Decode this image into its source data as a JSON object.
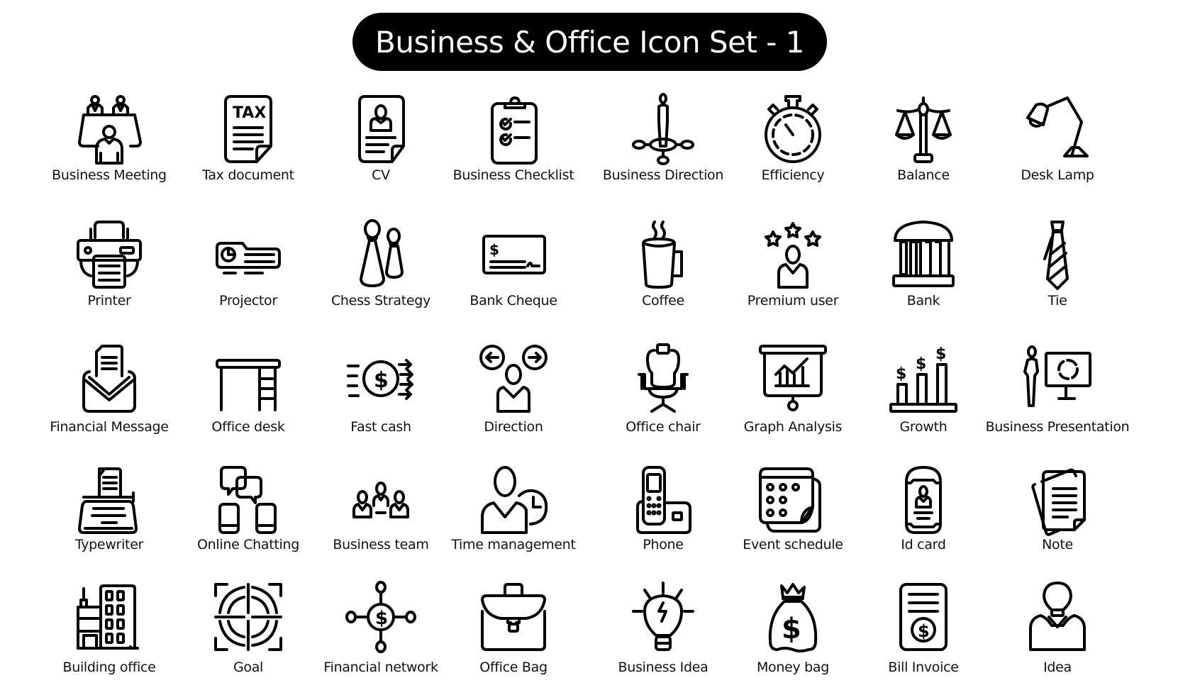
{
  "title": "Business & Office Icon Set - 1",
  "rows": [
    [
      {
        "label": "Business Meeting",
        "icon": "business-meeting-icon"
      },
      {
        "label": "Tax document",
        "icon": "tax-document-icon",
        "icon_text": "TAX"
      },
      {
        "label": "CV",
        "icon": "cv-icon"
      },
      {
        "label": "Business Checklist",
        "icon": "business-checklist-icon"
      },
      {
        "label": "Business Direction",
        "icon": "business-direction-icon"
      },
      {
        "label": "Efficiency",
        "icon": "stopwatch-icon"
      },
      {
        "label": "Balance",
        "icon": "balance-scale-icon"
      },
      {
        "label": "Desk Lamp",
        "icon": "desk-lamp-icon"
      }
    ],
    [
      {
        "label": "Printer",
        "icon": "printer-icon"
      },
      {
        "label": "Projector",
        "icon": "projector-icon"
      },
      {
        "label": "Chess Strategy",
        "icon": "chess-pawns-icon"
      },
      {
        "label": "Bank Cheque",
        "icon": "bank-cheque-icon",
        "icon_text": "$"
      },
      {
        "label": "Coffee",
        "icon": "coffee-mug-icon"
      },
      {
        "label": "Premium user",
        "icon": "premium-user-icon"
      },
      {
        "label": "Bank",
        "icon": "bank-building-icon"
      },
      {
        "label": "Tie",
        "icon": "necktie-icon"
      }
    ],
    [
      {
        "label": "Financial Message",
        "icon": "financial-message-icon"
      },
      {
        "label": "Office desk",
        "icon": "office-desk-icon"
      },
      {
        "label": "Fast cash",
        "icon": "fast-cash-icon",
        "icon_text": "$"
      },
      {
        "label": "Direction",
        "icon": "direction-icon"
      },
      {
        "label": "Office chair",
        "icon": "office-chair-icon"
      },
      {
        "label": "Graph Analysis",
        "icon": "graph-analysis-icon"
      },
      {
        "label": "Growth",
        "icon": "growth-chart-icon",
        "icon_text": "$"
      },
      {
        "label": "Business Presentation",
        "icon": "business-presentation-icon"
      }
    ],
    [
      {
        "label": "Typewriter",
        "icon": "typewriter-icon"
      },
      {
        "label": "Online Chatting",
        "icon": "online-chatting-icon"
      },
      {
        "label": "Business team",
        "icon": "business-team-icon"
      },
      {
        "label": "Time management",
        "icon": "time-management-icon"
      },
      {
        "label": "Phone",
        "icon": "phone-icon"
      },
      {
        "label": "Event schedule",
        "icon": "event-schedule-icon"
      },
      {
        "label": "Id card",
        "icon": "id-card-icon"
      },
      {
        "label": "Note",
        "icon": "note-icon"
      }
    ],
    [
      {
        "label": "Building office",
        "icon": "office-building-icon"
      },
      {
        "label": "Goal",
        "icon": "goal-target-icon"
      },
      {
        "label": "Financial network",
        "icon": "financial-network-icon",
        "icon_text": "$"
      },
      {
        "label": "Office Bag",
        "icon": "briefcase-icon"
      },
      {
        "label": "Business Idea",
        "icon": "lightbulb-icon"
      },
      {
        "label": "Money bag",
        "icon": "money-bag-icon",
        "icon_text": "$"
      },
      {
        "label": "Bill Invoice",
        "icon": "bill-invoice-icon",
        "icon_text": "$"
      },
      {
        "label": "Idea",
        "icon": "idea-person-icon"
      }
    ]
  ]
}
